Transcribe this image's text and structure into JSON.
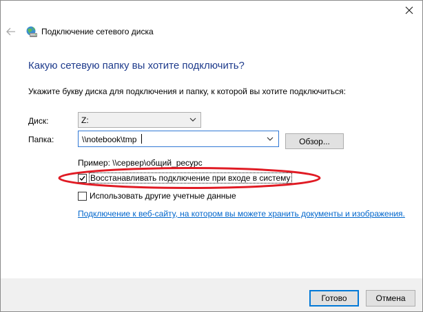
{
  "window": {
    "title": "Подключение сетевого диска"
  },
  "heading": "Какую сетевую папку вы хотите подключить?",
  "instruction": "Укажите букву диска для подключения и папку, к которой вы хотите подключиться:",
  "drive": {
    "label": "Диск:",
    "value": "Z:"
  },
  "folder": {
    "label": "Папка:",
    "value": "\\\\notebook\\tmp",
    "browse_label": "Обзор..."
  },
  "example": "Пример: \\\\сервер\\общий_ресурс",
  "options": {
    "reconnect": {
      "label": "Восстанавливать подключение при входе в систему",
      "checked": true
    },
    "other_credentials": {
      "label": "Использовать другие учетные данные",
      "checked": false
    }
  },
  "link": "Подключение к веб-сайту, на котором вы можете хранить документы и изображения.",
  "buttons": {
    "finish": "Готово",
    "cancel": "Отмена"
  },
  "colors": {
    "heading": "#1e3b8c",
    "link": "#0066cc",
    "highlight_ellipse": "#e01b24",
    "focus_border": "#0078d7"
  }
}
